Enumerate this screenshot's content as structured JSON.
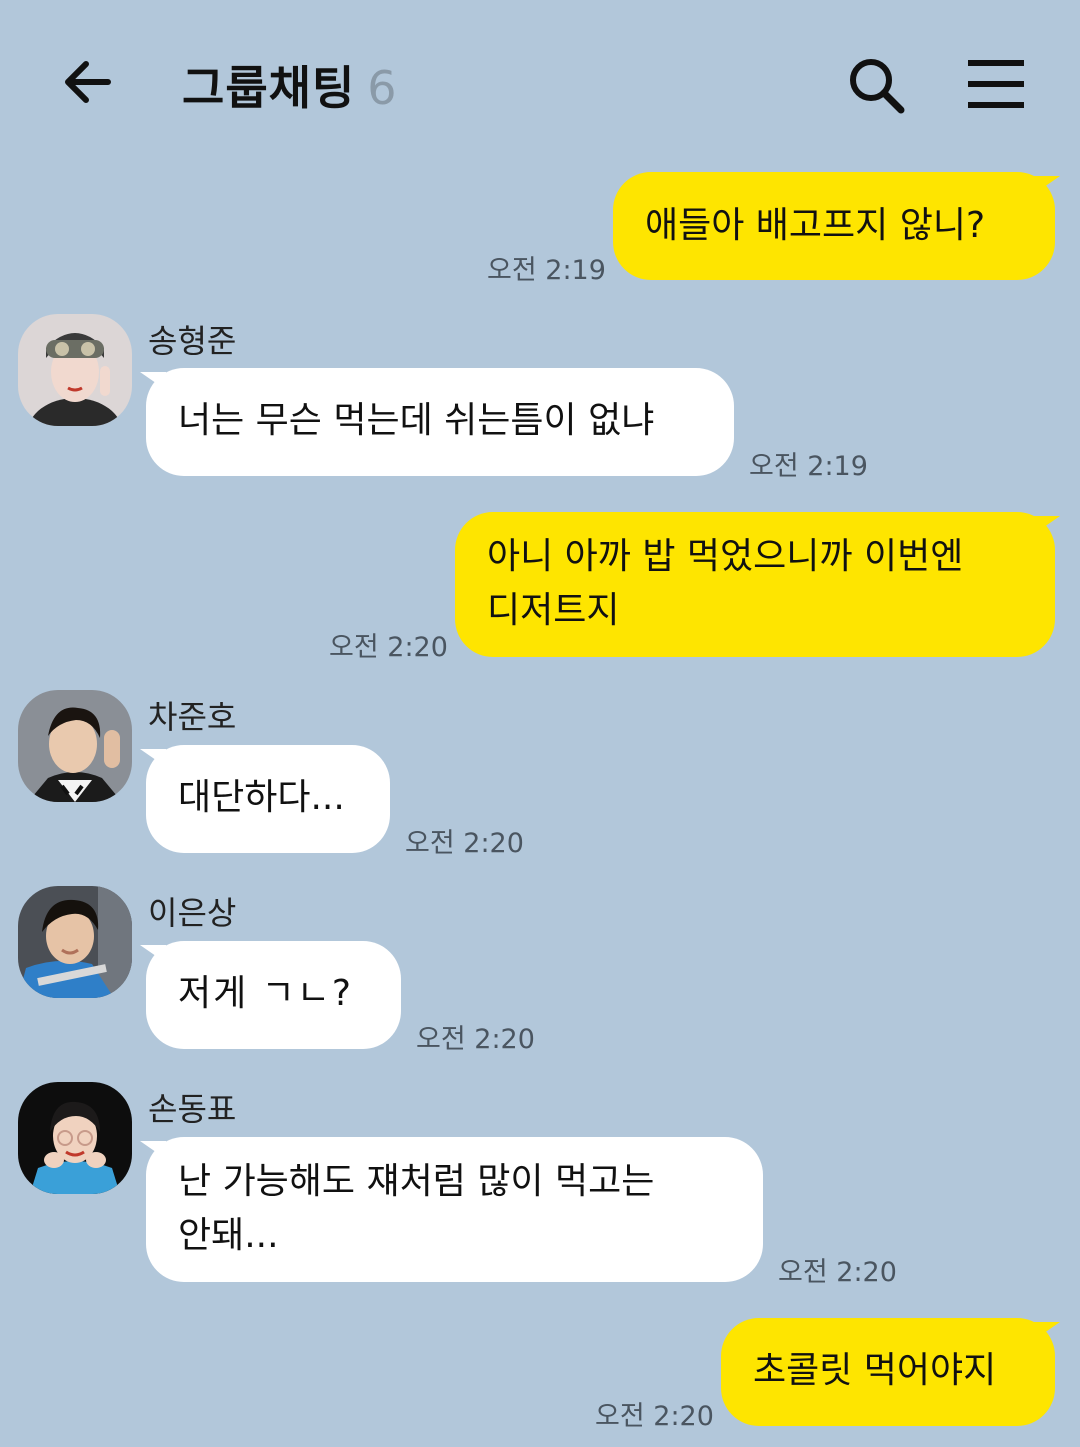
{
  "header": {
    "title": "그룹채팅",
    "member_count": "6"
  },
  "messages": [
    {
      "side": "me",
      "text": "애들아 배고프지 않니?",
      "time": "오전 2:19"
    },
    {
      "side": "other",
      "sender": "송형준",
      "text": "너는 무슨 먹는데 쉬는틈이 없냐",
      "time": "오전 2:19"
    },
    {
      "side": "me",
      "text": "아니 아까 밥 먹었으니까 이번엔\n디저트지",
      "time": "오전 2:20"
    },
    {
      "side": "other",
      "sender": "차준호",
      "text": "대단하다...",
      "time": "오전 2:20"
    },
    {
      "side": "other",
      "sender": "이은상",
      "text": "저게 ㄱㄴ?",
      "time": "오전 2:20"
    },
    {
      "side": "other",
      "sender": "손동표",
      "text": "난 가능해도 쟤처럼 많이 먹고는\n안돼...",
      "time": "오전 2:20"
    },
    {
      "side": "me",
      "text": "초콜릿 먹어야지",
      "time": "오전 2:20"
    }
  ],
  "colors": {
    "background": "#b2c7da",
    "my_bubble": "#fee500",
    "other_bubble": "#ffffff"
  }
}
